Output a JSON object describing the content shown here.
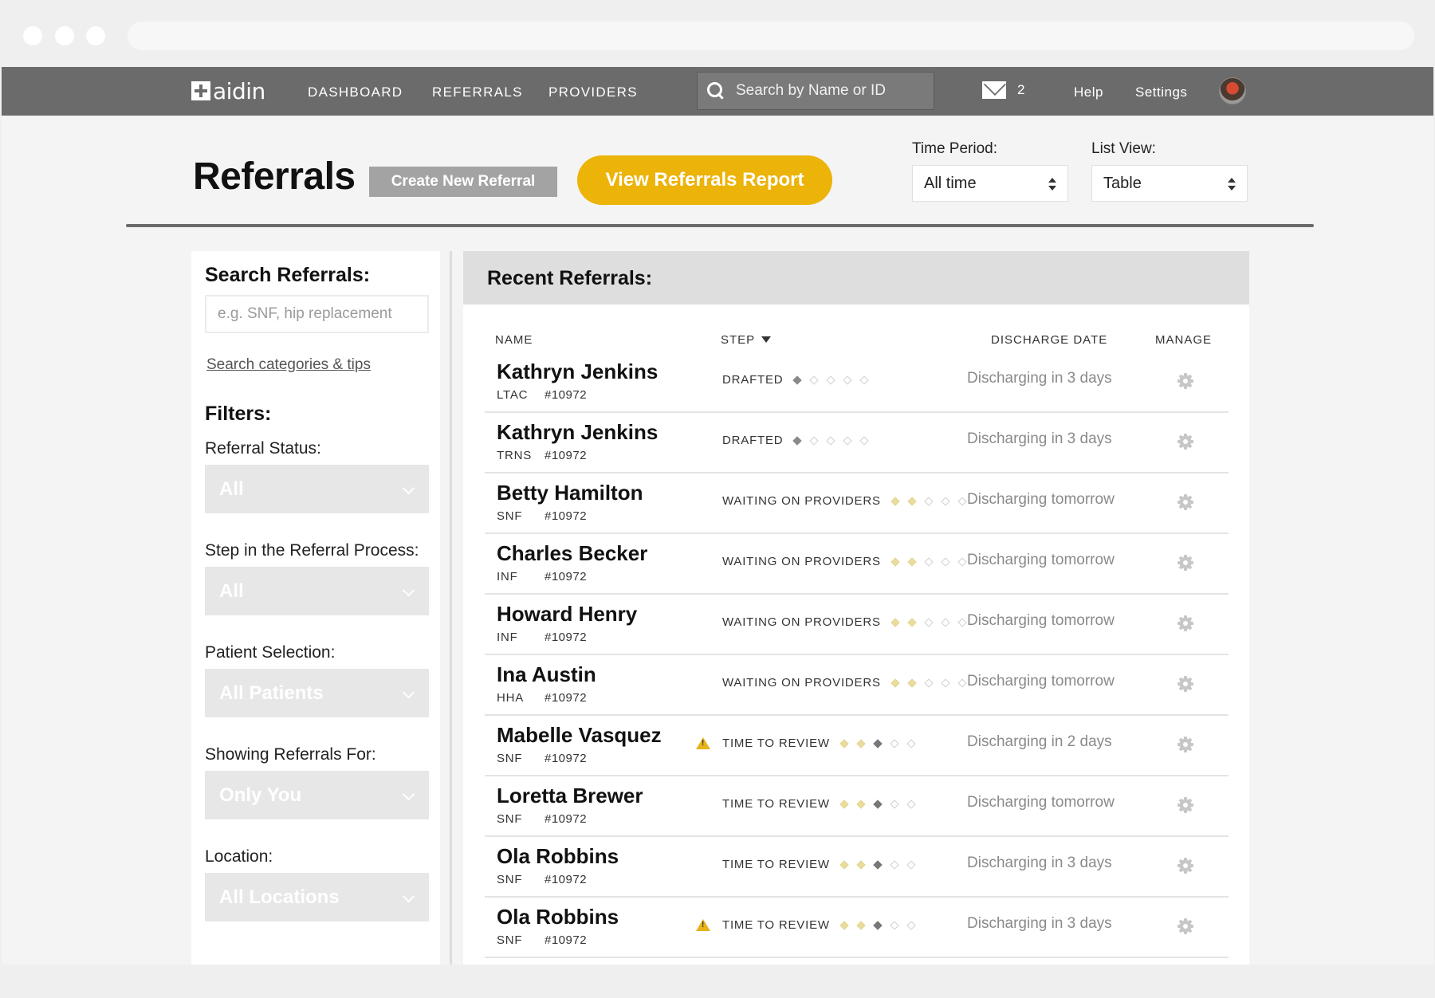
{
  "nav": {
    "logo": "aidin",
    "links": [
      "DASHBOARD",
      "REFERRALS",
      "PROVIDERS"
    ],
    "search_placeholder": "Search by Name or ID",
    "mail_count": "2",
    "help": "Help",
    "settings": "Settings"
  },
  "header": {
    "title": "Referrals",
    "create_button": "Create New Referral",
    "report_button": "View Referrals Report",
    "time_period_label": "Time Period:",
    "time_period_value": "All time",
    "list_view_label": "List View:",
    "list_view_value": "Table"
  },
  "sidebar": {
    "search_heading": "Search Referrals:",
    "search_placeholder": "e.g. SNF, hip replacement",
    "search_link": "Search categories & tips",
    "filters_heading": "Filters:",
    "filters": [
      {
        "label": "Referral Status:",
        "value": "All"
      },
      {
        "label": "Step in the Referral Process:",
        "value": "All"
      },
      {
        "label": "Patient Selection:",
        "value": "All Patients"
      },
      {
        "label": "Showing Referrals For:",
        "value": "Only You"
      },
      {
        "label": "Location:",
        "value": "All Locations"
      }
    ]
  },
  "main": {
    "title": "Recent Referrals:",
    "columns": {
      "name": "NAME",
      "step": "STEP",
      "discharge": "DISCHARGE DATE",
      "manage": "MANAGE"
    },
    "rows": [
      {
        "name": "Kathryn Jenkins",
        "type": "LTAC",
        "id": "#10972",
        "step": "DRAFTED",
        "progress": 1,
        "warning": false,
        "discharge": "Discharging in 3 days"
      },
      {
        "name": "Kathryn Jenkins",
        "type": "TRNS",
        "id": "#10972",
        "step": "DRAFTED",
        "progress": 1,
        "warning": false,
        "discharge": "Discharging in 3 days"
      },
      {
        "name": "Betty Hamilton",
        "type": "SNF",
        "id": "#10972",
        "step": "WAITING ON PROVIDERS",
        "progress": 2,
        "warning": false,
        "discharge": "Discharging tomorrow"
      },
      {
        "name": "Charles Becker",
        "type": "INF",
        "id": "#10972",
        "step": "WAITING ON PROVIDERS",
        "progress": 2,
        "warning": false,
        "discharge": "Discharging tomorrow"
      },
      {
        "name": "Howard Henry",
        "type": "INF",
        "id": "#10972",
        "step": "WAITING ON PROVIDERS",
        "progress": 2,
        "warning": false,
        "discharge": "Discharging tomorrow"
      },
      {
        "name": "Ina Austin",
        "type": "HHA",
        "id": "#10972",
        "step": "WAITING ON PROVIDERS",
        "progress": 2,
        "warning": false,
        "discharge": "Discharging tomorrow"
      },
      {
        "name": "Mabelle Vasquez",
        "type": "SNF",
        "id": "#10972",
        "step": "TIME TO REVIEW",
        "progress": 3,
        "warning": true,
        "discharge": "Discharging in 2 days"
      },
      {
        "name": "Loretta Brewer",
        "type": "SNF",
        "id": "#10972",
        "step": "TIME TO REVIEW",
        "progress": 3,
        "warning": false,
        "discharge": "Discharging tomorrow"
      },
      {
        "name": "Ola Robbins",
        "type": "SNF",
        "id": "#10972",
        "step": "TIME TO REVIEW",
        "progress": 3,
        "warning": false,
        "discharge": "Discharging in 3 days"
      },
      {
        "name": "Ola Robbins",
        "type": "SNF",
        "id": "#10972",
        "step": "TIME TO REVIEW",
        "progress": 3,
        "warning": true,
        "discharge": "Discharging in 3 days"
      }
    ]
  },
  "colors": {
    "nav_bg": "#6b6b6b",
    "accent": "#ecb308",
    "warning": "#e6b31a"
  }
}
